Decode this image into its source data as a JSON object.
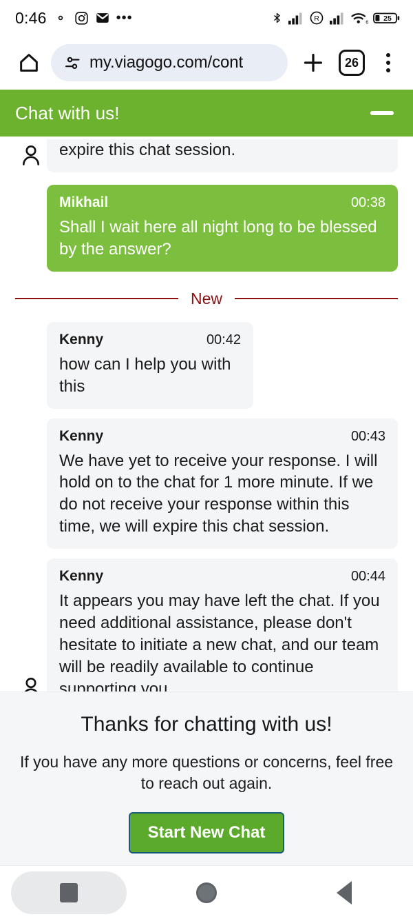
{
  "status_bar": {
    "time": "0:46",
    "left_icons": [
      "settings-gear-notification-icon",
      "instagram-icon",
      "gmail-envelope-icon",
      "more-notifications-icon"
    ],
    "right_icons": [
      "bluetooth-icon",
      "signal-bars-icon",
      "roaming-r-icon",
      "signal-bars-2-icon",
      "wifi-6-icon"
    ],
    "battery_percent": "25"
  },
  "browser": {
    "home_icon": "home-icon",
    "site_settings_icon": "site-settings-tune-icon",
    "url": "my.viagogo.com/cont",
    "new_tab_icon": "plus-icon",
    "tab_count": "26",
    "menu_icon": "three-dot-menu-icon"
  },
  "chat": {
    "header_title": "Chat with us!",
    "minimize_icon": "minimize-icon",
    "avatar_icon": "person-avatar-icon",
    "divider_label": "New",
    "accent_green": "#6cb22e",
    "bubble_green": "#7cbf3f",
    "divider_red": "#8c1010",
    "messages": [
      {
        "name": "",
        "time": "",
        "text": "expire this chat session.",
        "side": "agent",
        "partial": true
      },
      {
        "name": "Mikhail",
        "time": "00:38",
        "text": "Shall I wait here all night long to be blessed by the answer?",
        "side": "me",
        "partial": false
      },
      {
        "name": "Kenny",
        "time": "00:42",
        "text": "how can I help you with this",
        "side": "agent",
        "partial": false
      },
      {
        "name": "Kenny",
        "time": "00:43",
        "text": "We have yet to receive your response. I will hold on to the chat for 1 more minute. If we do not receive your response within this time, we will expire this chat session.",
        "side": "agent",
        "partial": false
      },
      {
        "name": "Kenny",
        "time": "00:44",
        "text": "It appears you may have left the chat. If you need additional assistance, please don't hesitate to initiate a new chat, and our team will be readily available to continue supporting you.",
        "side": "agent",
        "partial": false
      }
    ]
  },
  "footer": {
    "heading": "Thanks for chatting with us!",
    "subtext": "If you have any more questions or concerns, feel free to reach out again.",
    "button_label": "Start New Chat",
    "button_color": "#5caa2b"
  },
  "navbar": {
    "recents_icon": "recents-square-icon",
    "home_icon": "home-circle-icon",
    "back_icon": "back-triangle-icon"
  }
}
